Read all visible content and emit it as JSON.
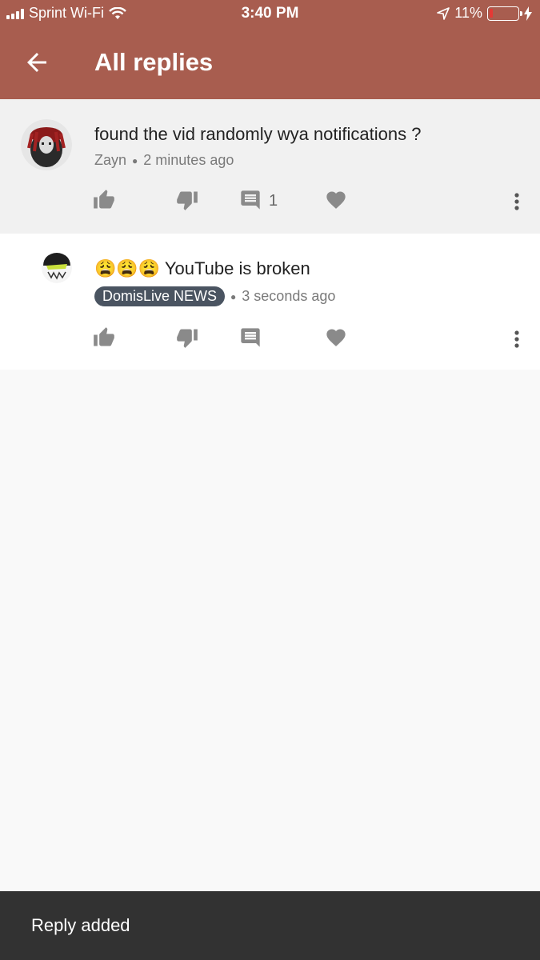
{
  "status_bar": {
    "carrier": "Sprint Wi-Fi",
    "time": "3:40 PM",
    "battery_percent": "11%",
    "battery_level": 0.11,
    "icons": [
      "signal-icon",
      "wifi-icon",
      "location-arrow-icon",
      "battery-icon",
      "charging-bolt-icon"
    ]
  },
  "appbar": {
    "title": "All replies",
    "back_icon": "arrow-left-icon",
    "color": "#a85d4f"
  },
  "comments": [
    {
      "text": "found the vid randomly wya notifications ?",
      "author": "Zayn",
      "time": "2 minutes ago",
      "reply_count": "1",
      "actions": [
        "thumb-up-icon",
        "thumb-down-icon",
        "comment-icon",
        "heart-icon",
        "more-vert-icon"
      ]
    },
    {
      "emoji": "😩😩😩",
      "text": "YouTube is broken",
      "author": "DomisLive NEWS",
      "time": "3 seconds ago",
      "actions": [
        "thumb-up-icon",
        "thumb-down-icon",
        "comment-icon",
        "heart-icon",
        "more-vert-icon"
      ]
    }
  ],
  "toast": {
    "message": "Reply added"
  },
  "colors": {
    "icon_gray": "#8a8a8a",
    "author_badge": "#4a5461",
    "toast_bg": "#323232"
  }
}
